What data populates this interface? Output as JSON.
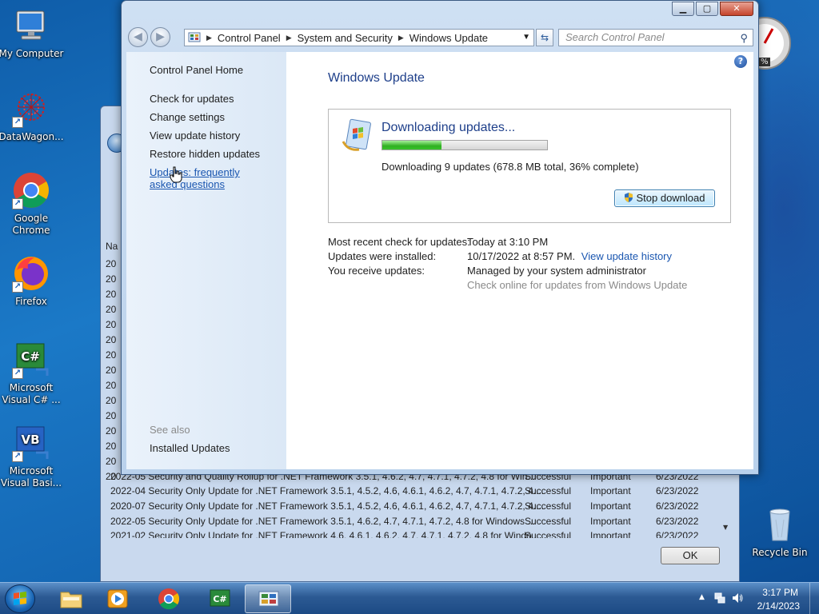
{
  "desktop": {
    "icons": [
      {
        "label": "My Computer"
      },
      {
        "label": "DataWagon..."
      },
      {
        "label": "Google Chrome"
      },
      {
        "label": "Firefox"
      },
      {
        "label": "Microsoft Visual C# ..."
      },
      {
        "label": "Microsoft Visual Basi..."
      },
      {
        "label": "Recycle Bin"
      }
    ],
    "gadget_text": "%"
  },
  "back_dialog": {
    "column_header_stub": "Na",
    "row_stubs": [
      "20",
      "20",
      "20",
      "20",
      "20",
      "20",
      "20",
      "20",
      "20",
      "20",
      "20",
      "20",
      "20",
      "20",
      "20"
    ],
    "rows": [
      {
        "name": "2022-05 Security and Quality Rollup for .NET Framework 3.5.1, 4.6.2, 4.7, 4.7.1, 4.7.2, 4.8 for Win...",
        "status": "Successful",
        "importance": "Important",
        "date": "6/23/2022"
      },
      {
        "name": "2022-04 Security Only Update for .NET Framework 3.5.1, 4.5.2, 4.6, 4.6.1, 4.6.2, 4.7, 4.7.1, 4.7.2, 4....",
        "status": "Successful",
        "importance": "Important",
        "date": "6/23/2022"
      },
      {
        "name": "2020-07 Security Only Update for .NET Framework 3.5.1, 4.5.2, 4.6, 4.6.1, 4.6.2, 4.7, 4.7.1, 4.7.2, 4....",
        "status": "Successful",
        "importance": "Important",
        "date": "6/23/2022"
      },
      {
        "name": "2022-05 Security Only Update for .NET Framework 3.5.1, 4.6.2, 4.7, 4.7.1, 4.7.2, 4.8 for Windows ...",
        "status": "Successful",
        "importance": "Important",
        "date": "6/23/2022"
      },
      {
        "name": "2021-02 Security Only Update for .NET Framework 4.6, 4.6.1, 4.6.2, 4.7, 4.7.1, 4.7.2, 4.8 for Windo...",
        "status": "Successful",
        "importance": "Important",
        "date": "6/23/2022"
      }
    ],
    "ok_label": "OK"
  },
  "window": {
    "address": {
      "crumbs": [
        "Control Panel",
        "System and Security",
        "Windows Update"
      ]
    },
    "search": {
      "placeholder": "Search Control Panel"
    },
    "sidebar": {
      "home": "Control Panel Home",
      "links": [
        "Check for updates",
        "Change settings",
        "View update history",
        "Restore hidden updates",
        "Updates: frequently asked questions"
      ],
      "see_also": "See also",
      "installed_updates": "Installed Updates"
    },
    "main": {
      "title": "Windows Update",
      "status_title": "Downloading updates...",
      "progress_fraction": 0.36,
      "progress_text": "Downloading 9 updates (678.8 MB total, 36% complete)",
      "stop_button": "Stop download",
      "info": {
        "recent_check_label": "Most recent check for updates:",
        "recent_check_value": "Today at 3:10 PM",
        "installed_label": "Updates were installed:",
        "installed_value": "10/17/2022 at 8:57 PM.",
        "history_link": "View update history",
        "receive_label": "You receive updates:",
        "receive_value": "Managed by your system administrator",
        "check_online": "Check online for updates from Windows Update"
      }
    }
  },
  "taskbar": {
    "clock_time": "3:17 PM",
    "clock_date": "2/14/2023"
  }
}
